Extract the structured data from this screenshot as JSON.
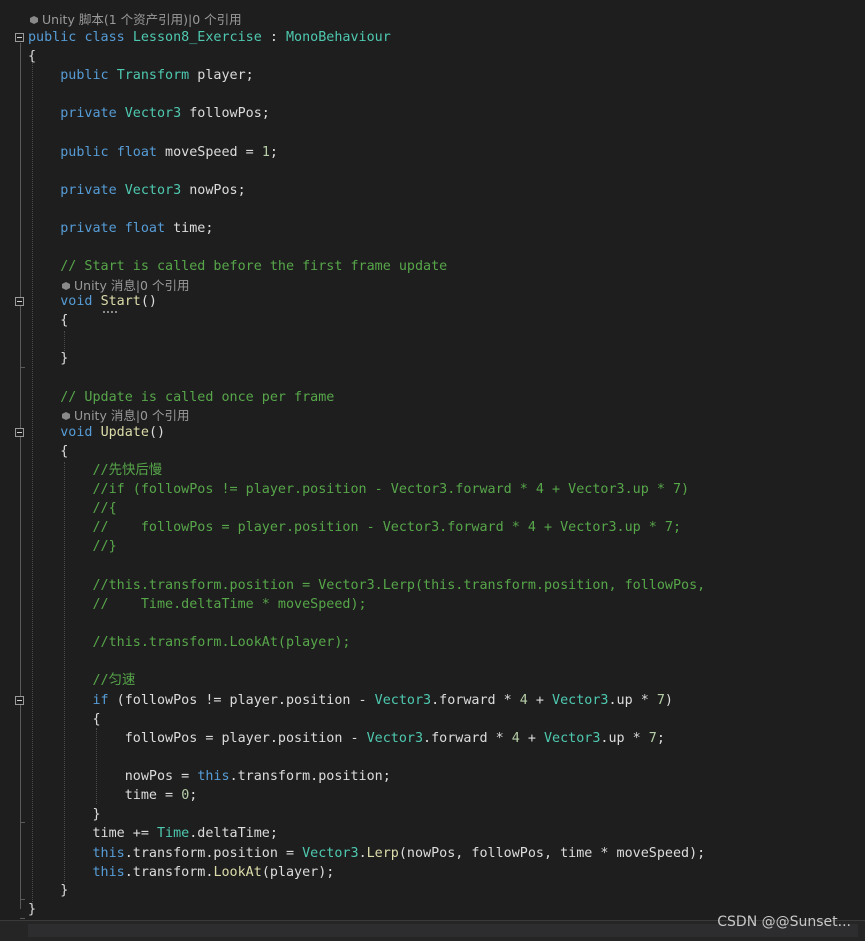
{
  "code_lens": {
    "class_lens": "Unity 脚本(1 个资产引用)|0 个引用",
    "start_lens": "Unity 消息|0 个引用",
    "update_lens": "Unity 消息|0 个引用"
  },
  "code": {
    "class_decl": {
      "kw_public": "public",
      "kw_class": "class",
      "class_name": "Lesson8_Exercise",
      "colon": " : ",
      "base": "MonoBehaviour"
    },
    "open_brace_class": "{",
    "player_field": {
      "kw": "public",
      "type": "Transform",
      "rest": " player;"
    },
    "followpos_field": {
      "kw": "private",
      "type": "Vector3",
      "rest": " followPos;"
    },
    "movespeed_field": {
      "kw": "public",
      "type": "float",
      "rest": " moveSpeed = ",
      "num": "1",
      "end": ";"
    },
    "nowpos_field": {
      "kw": "private",
      "type": "Vector3",
      "rest": " nowPos;"
    },
    "time_field": {
      "kw": "private",
      "type": "float",
      "rest": " time;"
    },
    "start_comment": "// Start is called before the first frame update",
    "start_decl": {
      "kw": "void",
      "name": "Start",
      "rest": "()"
    },
    "start_open": "{",
    "start_close": "}",
    "update_comment": "// Update is called once per frame",
    "update_decl": {
      "kw": "void",
      "name": "Update",
      "rest": "()"
    },
    "update_open": "{",
    "c1": "//先快后慢",
    "c2": "//if (followPos != player.position - Vector3.forward * 4 + Vector3.up * 7)",
    "c3": "//{",
    "c4": "//    followPos = player.position - Vector3.forward * 4 + Vector3.up * 7;",
    "c5": "//}",
    "c6": "//this.transform.position = Vector3.Lerp(this.transform.position, followPos,",
    "c7": "//    Time.deltaTime * moveSpeed);",
    "c8": "//this.transform.LookAt(player);",
    "c9": "//匀速",
    "if_line": {
      "kw": "if",
      "a": " (followPos != player.position - ",
      "t1": "Vector3",
      "b": ".forward * ",
      "n1": "4",
      "c": " + ",
      "t2": "Vector3",
      "d": ".up * ",
      "n2": "7",
      "e": ")"
    },
    "if_open": "{",
    "assign_line": {
      "a": "followPos = player.position - ",
      "t1": "Vector3",
      "b": ".forward * ",
      "n1": "4",
      "c": " + ",
      "t2": "Vector3",
      "d": ".up * ",
      "n2": "7",
      "e": ";"
    },
    "nowpos_line": {
      "a": "nowPos = ",
      "kw": "this",
      "b": ".transform.position;"
    },
    "time_zero_line": {
      "a": "time = ",
      "n": "0",
      "b": ";"
    },
    "if_close": "}",
    "time_add_line": {
      "a": "time += ",
      "t": "Time",
      "b": ".deltaTime;"
    },
    "lerp_line": {
      "kw": "this",
      "a": ".transform.position = ",
      "t": "Vector3",
      "b": ".",
      "m": "Lerp",
      "c": "(nowPos, followPos, time * moveSpeed);"
    },
    "lookat_line": {
      "kw": "this",
      "a": ".transform.",
      "m": "LookAt",
      "b": "(player);"
    },
    "update_close": "}",
    "class_close": "}"
  },
  "watermark": "CSDN @@Sunset...",
  "colors": {
    "background": "#1e1e1e",
    "keyword": "#569cd6",
    "type": "#4ec9b0",
    "comment": "#57a64a",
    "method": "#dcdcaa",
    "number": "#b5cea8",
    "text": "#dcdcdc"
  }
}
